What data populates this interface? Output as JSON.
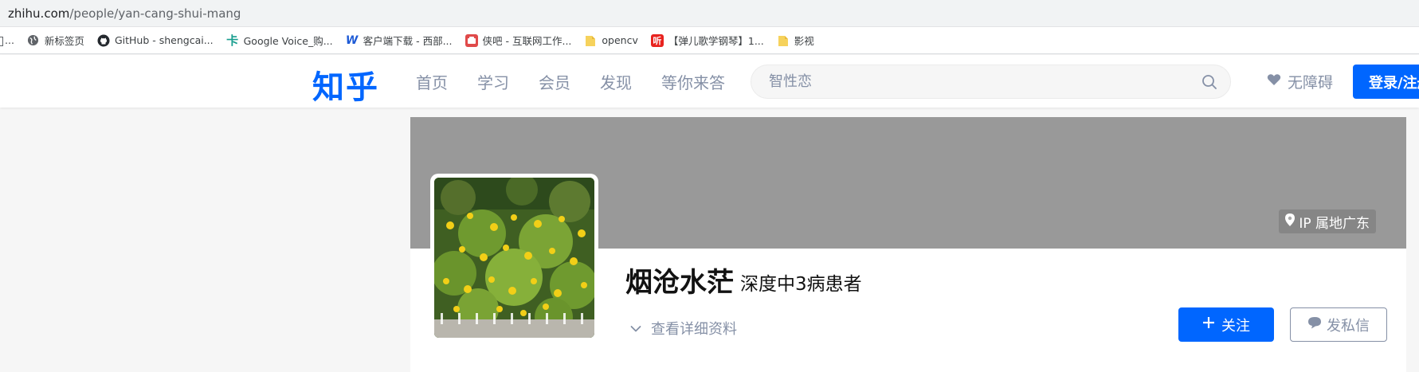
{
  "browser": {
    "url_domain": "zhihu.com",
    "url_path": "/people/yan-cang-shui-mang",
    "bookmarks": [
      {
        "label": "新标签页",
        "icon": "globe-icon"
      },
      {
        "label": "GitHub - shengcai...",
        "icon": "github-icon"
      },
      {
        "label": "Google Voice_购...",
        "icon": "card-icon"
      },
      {
        "label": "客户端下载 - 西部...",
        "icon": "w-logo-icon"
      },
      {
        "label": "侠吧 - 互联网工作...",
        "icon": "app-icon"
      },
      {
        "label": "opencv",
        "icon": "folder-icon"
      },
      {
        "label": "【弹儿歌学钢琴】1...",
        "icon": "ting-icon"
      },
      {
        "label": "影视",
        "icon": "folder-icon"
      }
    ],
    "bookmark_cutoff": "..."
  },
  "header": {
    "logo": "知乎",
    "tabs": [
      "首页",
      "学习",
      "会员",
      "发现",
      "等你来答"
    ],
    "search_placeholder": "智性恋",
    "accessibility_label": "无障碍",
    "login_label": "登录/注册"
  },
  "profile": {
    "ip_location": "IP 属地广东",
    "name": "烟沧水茫",
    "headline": "深度中3病患者",
    "details_link": "查看详细资料",
    "follow_label": "关注",
    "message_label": "发私信"
  },
  "colors": {
    "brand": "#0066ff",
    "muted_text": "#8590a6",
    "cover": "#999999"
  }
}
